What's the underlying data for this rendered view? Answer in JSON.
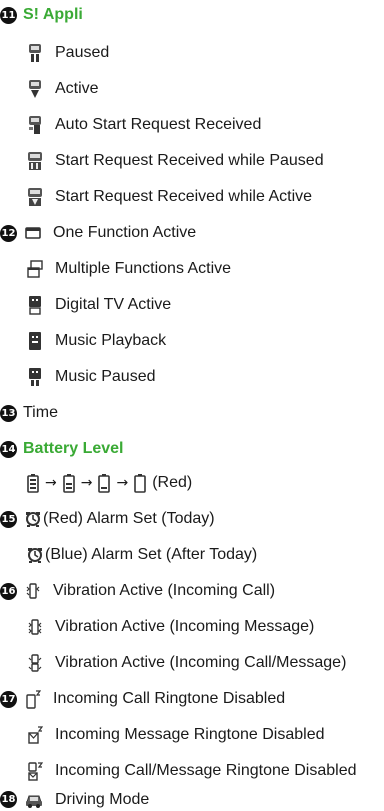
{
  "sections": [
    {
      "num": "11",
      "title": "S! Appli",
      "items": [
        "Paused",
        "Active",
        "Auto Start Request Received",
        "Start Request Received while Paused",
        "Start Request Received while Active"
      ]
    },
    {
      "num": "12",
      "items": [
        "One Function Active",
        "Multiple Functions Active",
        "Digital TV Active",
        "Music Playback",
        "Music Paused"
      ]
    },
    {
      "num": "13",
      "label": "Time"
    },
    {
      "num": "14",
      "title": "Battery Level",
      "battery_suffix": "(Red)",
      "arrow": "→"
    },
    {
      "num": "15",
      "items": [
        "(Red)  Alarm Set (Today)",
        "(Blue) Alarm Set (After Today)"
      ]
    },
    {
      "num": "16",
      "items": [
        "Vibration Active (Incoming Call)",
        "Vibration Active (Incoming Message)",
        "Vibration Active (Incoming Call/Message)"
      ]
    },
    {
      "num": "17",
      "items": [
        "Incoming Call Ringtone Disabled",
        "Incoming Message Ringtone Disabled",
        "Incoming Call/Message Ringtone Disabled"
      ]
    },
    {
      "num": "18",
      "items": [
        "Driving Mode"
      ]
    }
  ]
}
